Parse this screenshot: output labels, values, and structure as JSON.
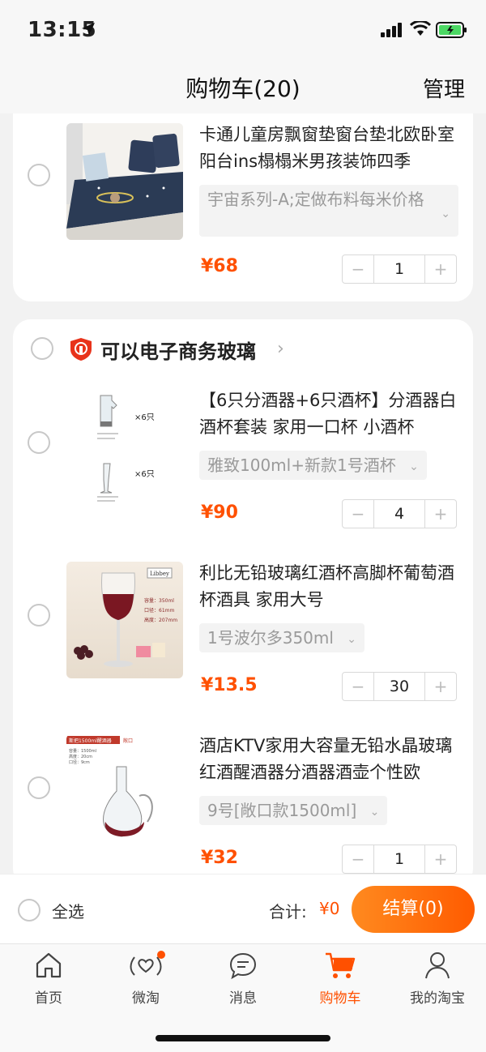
{
  "status_bar": {
    "time": "13:15"
  },
  "header": {
    "title": "购物车(20)",
    "manage": "管理"
  },
  "top_item": {
    "title": "卡通儿童房飘窗垫窗台垫北欧卧室阳台ins榻榻米男孩装饰四季",
    "sku": "宇宙系列-A;定做布料每米价格",
    "price": "¥68",
    "quantity": "1"
  },
  "shop": {
    "name": "可以电子商务玻璃",
    "items": [
      {
        "title": "【6只分酒器+6只酒杯】分酒器白酒杯套装 家用一口杯 小酒杯",
        "sku": "雅致100ml+新款1号酒杯",
        "price": "¥90",
        "quantity": "4",
        "thumb_text_1": "×6只",
        "thumb_text_2": "×6只"
      },
      {
        "title": "利比无铅玻璃红酒杯高脚杯葡萄酒杯酒具  家用大号",
        "sku": "1号波尔多350ml",
        "price": "¥13.5",
        "quantity": "30",
        "thumb_brand": "Libbey",
        "thumb_spec_1": "容量：350ml",
        "thumb_spec_2": "口径：61mm",
        "thumb_spec_3": "高度：207mm"
      },
      {
        "title": "酒店KTV家用大容量无铅水晶玻璃红酒醒酒器分酒器酒壶个性欧",
        "sku": "9号[敞口款1500ml]",
        "price": "¥32",
        "quantity": "1",
        "thumb_tag": "斯把1500ml醒酒器",
        "thumb_tag2": "敞口",
        "thumb_spec_1": "容量：1500ml",
        "thumb_spec_2": "高度：20cm",
        "thumb_spec_3": "口径：9cm"
      }
    ]
  },
  "summary": {
    "select_all": "全选",
    "total_label": "合计:",
    "total_value": "¥0",
    "checkout": "结算(0)"
  },
  "tabs": [
    {
      "label": "首页",
      "icon": "home-icon"
    },
    {
      "label": "微淘",
      "icon": "heart-wave-icon"
    },
    {
      "label": "消息",
      "icon": "chat-icon"
    },
    {
      "label": "购物车",
      "icon": "cart-icon",
      "active": true
    },
    {
      "label": "我的淘宝",
      "icon": "user-icon"
    }
  ],
  "colors": {
    "accent": "#ff5000",
    "checkout_start": "#ff8a1f",
    "checkout_end": "#ff5b00",
    "background": "#f2f2f2"
  },
  "stepper": {
    "minus": "−",
    "plus": "+"
  }
}
